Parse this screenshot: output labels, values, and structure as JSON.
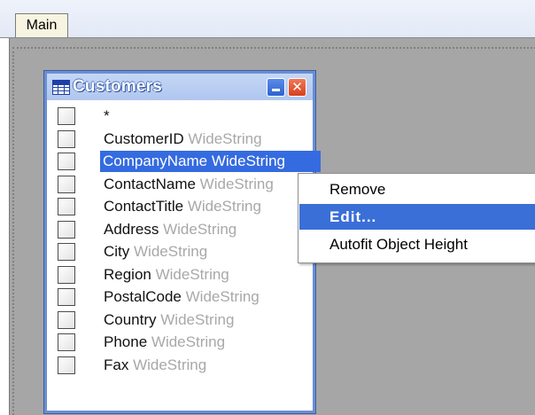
{
  "tabs": [
    {
      "label": "Main"
    }
  ],
  "table": {
    "title": "Customers",
    "close_glyph": "✕",
    "fields": [
      {
        "name": "*",
        "type": ""
      },
      {
        "name": "CustomerID",
        "type": "WideString"
      },
      {
        "name": "CompanyName",
        "type": "WideString"
      },
      {
        "name": "ContactName",
        "type": "WideString"
      },
      {
        "name": "ContactTitle",
        "type": "WideString"
      },
      {
        "name": "Address",
        "type": "WideString"
      },
      {
        "name": "City",
        "type": "WideString"
      },
      {
        "name": "Region",
        "type": "WideString"
      },
      {
        "name": "PostalCode",
        "type": "WideString"
      },
      {
        "name": "Country",
        "type": "WideString"
      },
      {
        "name": "Phone",
        "type": "WideString"
      },
      {
        "name": "Fax",
        "type": "WideString"
      }
    ],
    "selected_index": 2
  },
  "context_menu": {
    "items": [
      {
        "label": "Remove"
      },
      {
        "label": "Edit..."
      },
      {
        "label": "Autofit Object Height"
      }
    ],
    "highlighted_index": 1
  },
  "colors": {
    "selection": "#356be0",
    "canvas": "#a6a6a6",
    "type_text": "#a8a8a8"
  },
  "icons": {
    "table": "table-grid-icon",
    "minimize": "minimize-icon",
    "close": "close-icon"
  }
}
